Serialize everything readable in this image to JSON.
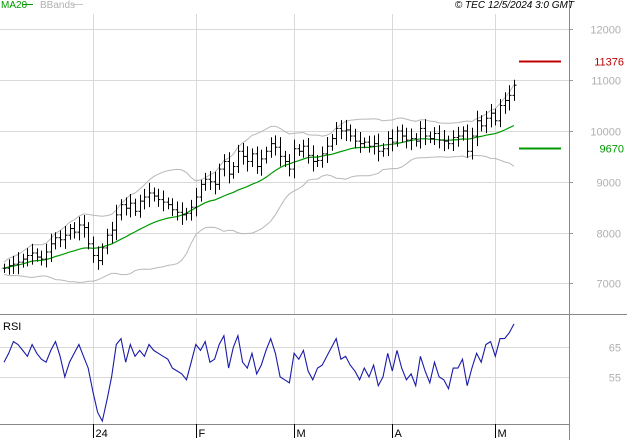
{
  "header": {
    "legend_ma": "MA20",
    "legend_bbands": "BBands",
    "copyright": "© TEC 12/5/2024 3:0 GMT"
  },
  "colors": {
    "background": "#ffffff",
    "grid": "#d9d9d9",
    "axis_label": "#b0b0b0",
    "bar": "#000000",
    "ma": "#009900",
    "bband": "#b8b8b8",
    "rsi": "#1a1aa8",
    "resistance": "#c00000",
    "support": "#009900",
    "legend_ma": "#009900",
    "legend_bbands": "#b0b0b0"
  },
  "chart_data": [
    {
      "type": "ohlc",
      "panel": "price",
      "y_ticks": [
        7000,
        8000,
        9000,
        10000,
        11000,
        12000
      ],
      "y_tick_labels": [
        "7000",
        "8000",
        "9000",
        "10000",
        "11000",
        "12000"
      ],
      "ylim": [
        6400,
        12300
      ],
      "grid": true,
      "x_labels": [
        {
          "text": "24",
          "index": 19
        },
        {
          "text": "F",
          "index": 41
        },
        {
          "text": "M",
          "index": 62
        },
        {
          "text": "A",
          "index": 83
        },
        {
          "text": "M",
          "index": 105
        }
      ],
      "n_bars": 110,
      "closes": [
        7300,
        7350,
        7380,
        7420,
        7480,
        7550,
        7600,
        7520,
        7480,
        7620,
        7780,
        7900,
        7860,
        7950,
        8080,
        8010,
        8150,
        8100,
        7780,
        7550,
        7450,
        7700,
        7950,
        8050,
        8350,
        8550,
        8480,
        8580,
        8420,
        8620,
        8700,
        8780,
        8720,
        8650,
        8600,
        8550,
        8450,
        8400,
        8350,
        8380,
        8500,
        8700,
        8950,
        9050,
        9000,
        8950,
        9250,
        9400,
        9150,
        9300,
        9600,
        9500,
        9400,
        9550,
        9300,
        9450,
        9600,
        9750,
        9680,
        9500,
        9400,
        9250,
        9650,
        9600,
        9700,
        9520,
        9400,
        9420,
        9550,
        9700,
        9850,
        10050,
        10000,
        10020,
        9900,
        9800,
        9750,
        9780,
        9700,
        9750,
        9600,
        9650,
        9850,
        9780,
        10000,
        9900,
        9820,
        9850,
        9800,
        10050,
        9900,
        9850,
        9950,
        9820,
        9800,
        9750,
        9870,
        9900,
        10000,
        9600,
        9900,
        10200,
        10100,
        10250,
        10350,
        10200,
        10500,
        10600,
        10700,
        10900
      ],
      "overlays": [
        {
          "name": "MA20",
          "period": 20
        },
        {
          "name": "BBands",
          "period": 20,
          "stdev": 2
        }
      ],
      "levels": [
        {
          "label": "11376",
          "value": 11376,
          "color": "#c00000"
        },
        {
          "label": "9670",
          "value": 9670,
          "color": "#009900"
        }
      ]
    },
    {
      "type": "line",
      "panel": "rsi",
      "title": "RSI",
      "y_ticks": [
        55,
        65
      ],
      "y_tick_labels": [
        "55",
        "65"
      ],
      "ylim": [
        39,
        75
      ],
      "values": [
        60,
        63,
        67,
        66,
        64,
        62,
        66,
        63,
        61,
        60,
        64,
        67,
        62,
        55,
        60,
        63,
        66,
        62,
        58,
        50,
        43,
        40,
        47,
        55,
        66,
        68,
        60,
        66,
        62,
        64,
        62,
        66,
        64,
        63,
        62,
        61,
        58,
        57,
        56,
        54,
        60,
        66,
        64,
        67,
        60,
        61,
        66,
        69,
        58,
        65,
        69,
        60,
        58,
        63,
        56,
        59,
        64,
        68,
        63,
        55,
        54,
        53,
        63,
        61,
        64,
        57,
        54,
        58,
        59,
        62,
        65,
        68,
        61,
        62,
        59,
        57,
        54,
        58,
        55,
        59,
        52,
        55,
        63,
        57,
        64,
        58,
        54,
        56,
        52,
        62,
        57,
        53,
        60,
        55,
        54,
        51,
        58,
        58,
        61,
        52,
        58,
        63,
        60,
        66,
        67,
        62,
        68,
        68,
        70,
        73
      ]
    }
  ]
}
